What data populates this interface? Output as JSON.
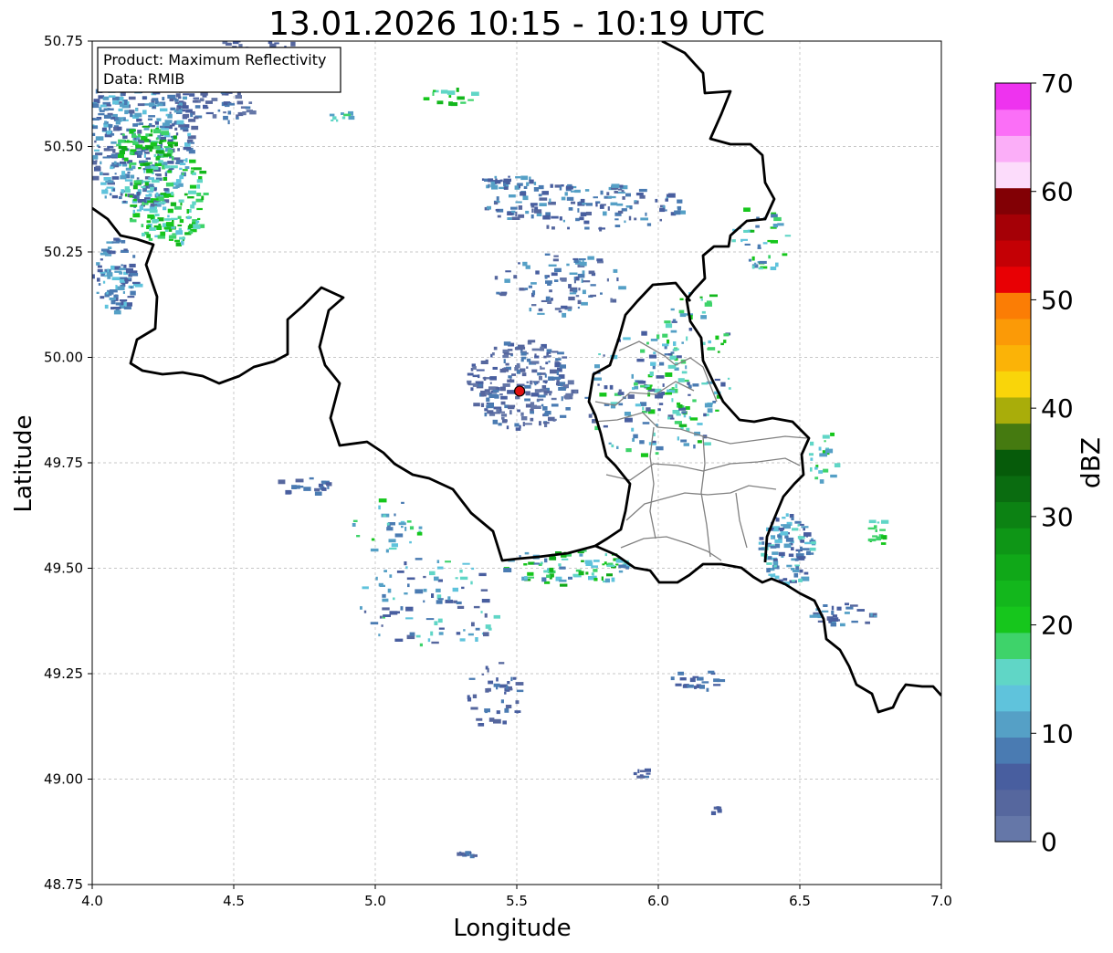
{
  "title": "13.01.2026 10:15 - 10:19 UTC",
  "info_box": {
    "product": "Product: Maximum Reflectivity",
    "source": "Data: RMIB"
  },
  "axes": {
    "xlabel": "Longitude",
    "ylabel": "Latitude",
    "xlim": [
      4.0,
      7.0
    ],
    "ylim": [
      48.75,
      50.75
    ],
    "x_ticks": [
      "4.0",
      "4.5",
      "5.0",
      "5.5",
      "6.0",
      "6.5",
      "7.0"
    ],
    "y_ticks": [
      "50.75",
      "50.50",
      "50.25",
      "50.00",
      "49.75",
      "49.50",
      "49.25",
      "49.00",
      "48.75"
    ],
    "grid": "on (dashed)"
  },
  "radar_site": {
    "lon": 5.51,
    "lat": 49.92,
    "color": "#e01010"
  },
  "colorbar": {
    "label": "dBZ",
    "ticks": [
      "0",
      "10",
      "20",
      "30",
      "40",
      "50",
      "60",
      "70"
    ],
    "range": [
      0,
      70
    ],
    "colors": [
      "#6577a8",
      "#56679e",
      "#485e9f",
      "#4a7bb2",
      "#55a0c6",
      "#5fc3dc",
      "#60d6c6",
      "#3ed36a",
      "#16c61c",
      "#13b71c",
      "#10a818",
      "#0e9616",
      "#0c8213",
      "#0a6c10",
      "#065b0a",
      "#457a10",
      "#a9ad0a",
      "#f9d50a",
      "#fbb307",
      "#fb9a07",
      "#fb7d05",
      "#e80004",
      "#c40005",
      "#a50006",
      "#820005",
      "#fcdcfb",
      "#fbaef8",
      "#fb6ff7",
      "#ee33ef"
    ]
  },
  "map_colors": {
    "national_border": "#000000",
    "region_border": "#808080",
    "grid": "#b5b5b5"
  }
}
